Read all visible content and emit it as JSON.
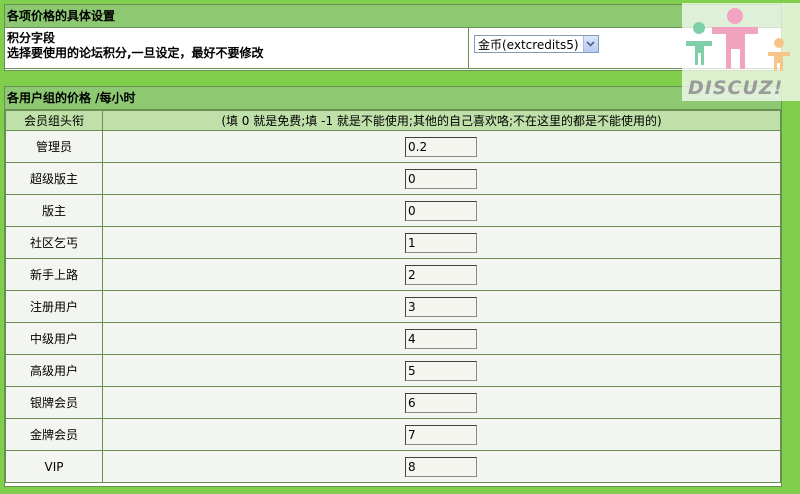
{
  "credit_section": {
    "header": "各项价格的具体设置",
    "label_line1": "积分字段",
    "label_line2": "选择要使用的论坛积分,一旦设定，最好不要修改",
    "select_value": "金币(extcredits5)"
  },
  "price_section": {
    "header": "各用户组的价格 /每小时",
    "col_group": "会员组头衔",
    "col_note": "(填 0 就是免费;填 -1 就是不能使用;其他的自己喜欢咯;不在这里的都是不能使用的)",
    "rows": [
      {
        "group": "管理员",
        "price": "0.2"
      },
      {
        "group": "超级版主",
        "price": "0"
      },
      {
        "group": "版主",
        "price": "0"
      },
      {
        "group": "社区乞丐",
        "price": "1"
      },
      {
        "group": "新手上路",
        "price": "2"
      },
      {
        "group": "注册用户",
        "price": "3"
      },
      {
        "group": "中级用户",
        "price": "4"
      },
      {
        "group": "高级用户",
        "price": "5"
      },
      {
        "group": "银牌会员",
        "price": "6"
      },
      {
        "group": "金牌会员",
        "price": "7"
      },
      {
        "group": "VIP",
        "price": "8"
      }
    ]
  },
  "logo": {
    "text": "DISCUZ!",
    "icon": "people-family-icon"
  },
  "colors": {
    "page_background": "#7fcf4c",
    "header_background": "#8dc873",
    "column_header_background": "#bfe0a8",
    "row_background": "#f3f6f0",
    "logo_pink": "#f2a3c0",
    "logo_green": "#7fd0a8",
    "logo_orange": "#f7c48a"
  }
}
